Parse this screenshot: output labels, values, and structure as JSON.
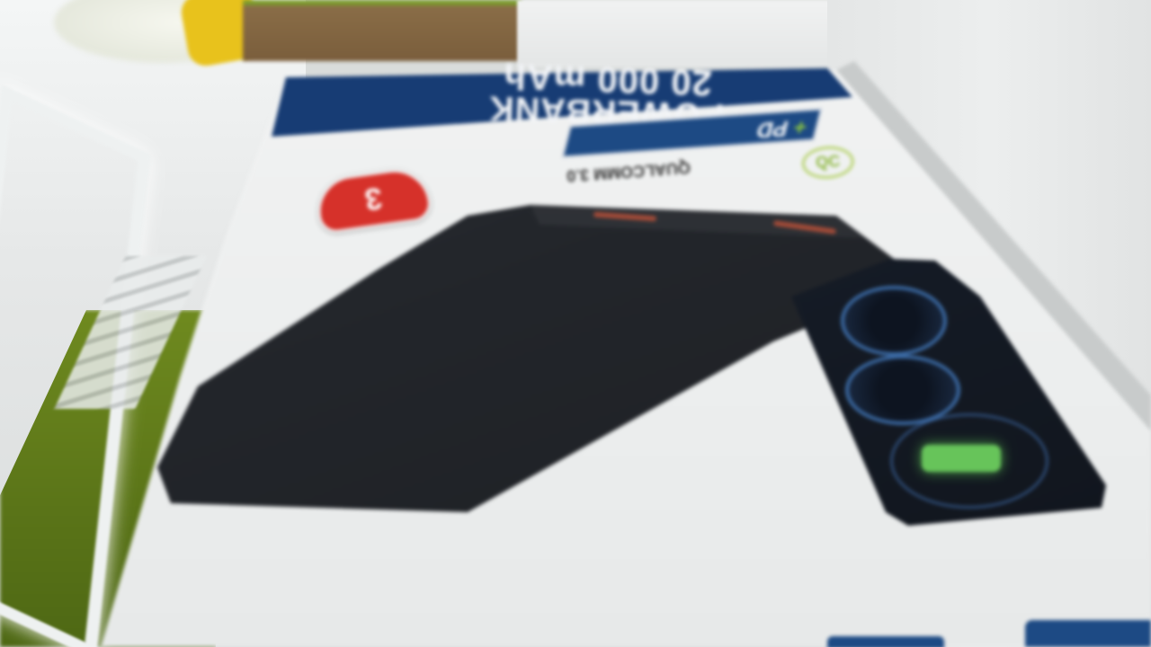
{
  "scene": {
    "description_label": "",
    "product_box": {
      "band_text": "POWERBANK",
      "capacity_text": "20 000 mAh",
      "brand_badge": "3",
      "pd_badge_text": "PD",
      "qc_text": "QUALCOMM 3.0",
      "qc_icon_text": "QC",
      "bottom_texts": [
        "",
        "",
        "",
        ""
      ]
    },
    "colors": {
      "band_blue": "#173c74",
      "badge_red": "#d6312a",
      "phone_indicator_green": "#67c45a",
      "floor_green": "#5a7418"
    }
  }
}
